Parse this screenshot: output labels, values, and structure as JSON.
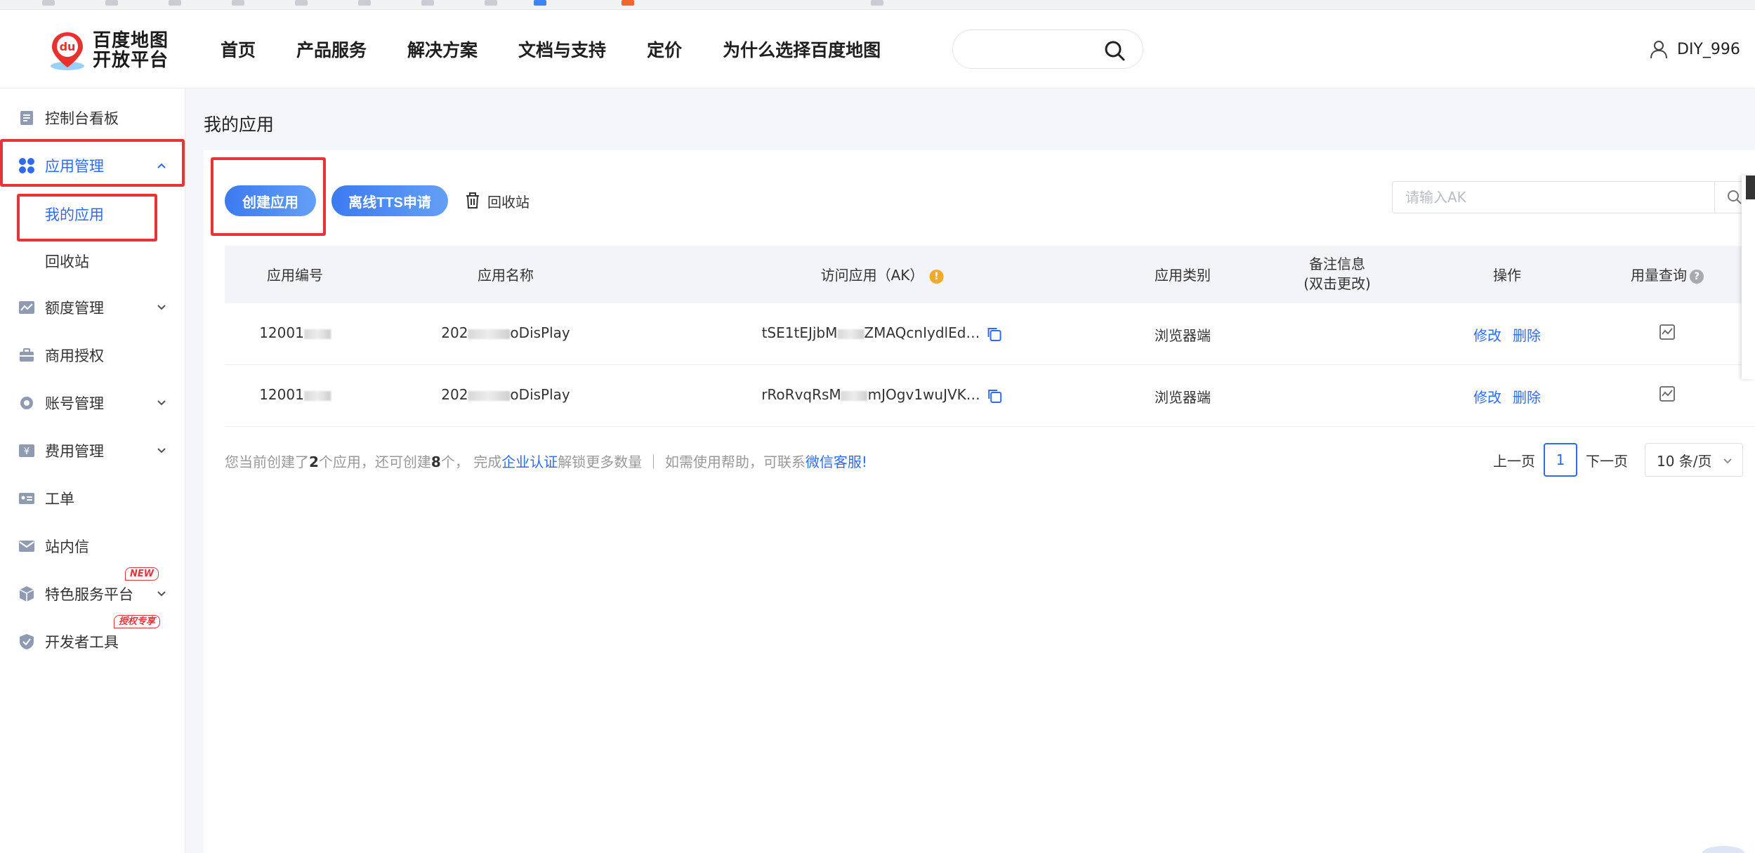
{
  "header": {
    "logo_line1": "百度地图",
    "logo_line2": "开放平台",
    "logo_badge": "du",
    "nav": [
      "首页",
      "产品服务",
      "解决方案",
      "文档与支持",
      "定价",
      "为什么选择百度地图"
    ],
    "username": "DIY_996"
  },
  "sidebar": {
    "dashboard": "控制台看板",
    "app_mgmt": "应用管理",
    "my_apps": "我的应用",
    "recycle": "回收站",
    "quota": "额度管理",
    "commercial": "商用授权",
    "account": "账号管理",
    "billing": "费用管理",
    "ticket": "工单",
    "inbox": "站内信",
    "special": "特色服务平台",
    "special_badge": "NEW",
    "devtools": "开发者工具",
    "devtools_badge": "授权专享"
  },
  "main": {
    "title": "我的应用",
    "create_btn": "创建应用",
    "tts_btn": "离线TTS申请",
    "recycle_btn": "回收站",
    "ak_placeholder": "请输入AK"
  },
  "table": {
    "headers": {
      "id": "应用编号",
      "name": "应用名称",
      "ak": "访问应用（AK）",
      "type": "应用类别",
      "remark_line1": "备注信息",
      "remark_line2": "(双击更改)",
      "ops": "操作",
      "usage": "用量查询"
    },
    "rows": [
      {
        "id_prefix": "12001",
        "name_prefix": "202",
        "name_suffix": "oDisPlay",
        "ak_prefix": "tSE1tEJjbM",
        "ak_suffix": "ZMAQcnIydlEd…",
        "type": "浏览器端",
        "edit": "修改",
        "delete": "删除"
      },
      {
        "id_prefix": "12001",
        "name_prefix": "202",
        "name_suffix": "oDisPlay",
        "ak_prefix": "rRoRvqRsM",
        "ak_suffix": "mJOgv1wuJVK…",
        "type": "浏览器端",
        "edit": "修改",
        "delete": "删除"
      }
    ]
  },
  "footer": {
    "t1": "您当前创建了",
    "created": "2",
    "t2": "个应用，还可创建",
    "remain": "8",
    "t3": "个，  完成",
    "cert_link": "企业认证",
    "t4": "解锁更多数量  ｜  如需使用帮助，可联系",
    "wechat_link": "微信客服!"
  },
  "pager": {
    "prev": "上一页",
    "current": "1",
    "next": "下一页",
    "page_size": "10 条/页"
  },
  "colors": {
    "accent": "#2f6bf0",
    "highlight_box": "#e83338",
    "warn": "#f0a92b"
  }
}
